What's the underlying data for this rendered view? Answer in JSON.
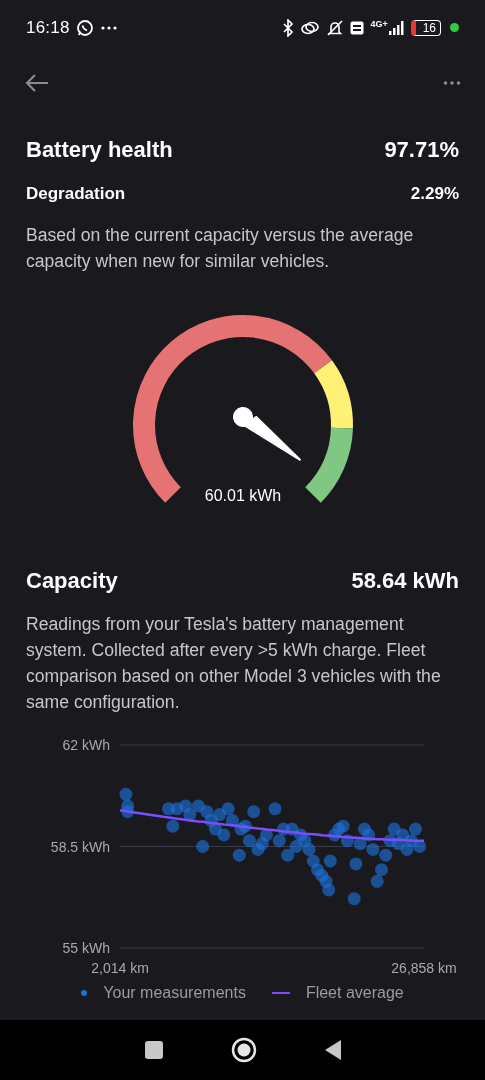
{
  "status_bar": {
    "time": "16:18",
    "network": "4G+",
    "battery": "16"
  },
  "health": {
    "title": "Battery health",
    "value": "97.71%",
    "degradation_label": "Degradation",
    "degradation_value": "2.29%",
    "description": "Based on the current capacity versus the average capacity when new for similar vehicles."
  },
  "gauge": {
    "reading": "60.01 kWh",
    "segments": [
      {
        "color": "#e57373"
      },
      {
        "color": "#fff176"
      },
      {
        "color": "#81c784"
      }
    ]
  },
  "capacity": {
    "title": "Capacity",
    "value": "58.64 kWh",
    "description": "Readings from your Tesla's battery management system. Collected after every >5 kWh charge. Fleet comparison based on other Model 3 vehicles with the same configuration.",
    "chart_data": {
      "type": "scatter",
      "xlim": [
        2014,
        26858
      ],
      "ylim": [
        55,
        62
      ],
      "xticks": [
        {
          "value": 2014,
          "label": "2,014 km"
        },
        {
          "value": 26858,
          "label": "26,858 km"
        }
      ],
      "yticks": [
        {
          "value": 62,
          "label": "62 kWh"
        },
        {
          "value": 58.5,
          "label": "58.5 kWh"
        },
        {
          "value": 55,
          "label": "55 kWh"
        }
      ],
      "x": [
        2014,
        2500,
        2640,
        2640,
        5980,
        6330,
        6680,
        7370,
        7720,
        8420,
        8770,
        9110,
        9460,
        9810,
        10160,
        10500,
        10850,
        11200,
        11760,
        11900,
        12250,
        12590,
        12940,
        13290,
        13640,
        13980,
        14680,
        15030,
        15380,
        15720,
        16070,
        16420,
        16770,
        17120,
        17460,
        17810,
        18160,
        18510,
        18860,
        19070,
        19200,
        19550,
        19900,
        20250,
        20600,
        21150,
        21290,
        21640,
        21990,
        22340,
        22680,
        23030,
        23380,
        23730,
        24080,
        24420,
        24770,
        25120,
        25470,
        25820,
        26160,
        26510,
        26858
      ],
      "series": [
        {
          "name": "Your measurements",
          "color": "#1e6fd6",
          "type": "scatter",
          "values": [
            null,
            60.3,
            59.9,
            59.7,
            59.8,
            59.2,
            59.8,
            59.9,
            59.6,
            59.9,
            58.5,
            59.7,
            59.4,
            59.1,
            59.6,
            58.9,
            59.8,
            59.4,
            58.2,
            59.1,
            59.2,
            58.7,
            59.7,
            58.4,
            58.6,
            58.9,
            59.8,
            58.7,
            59.1,
            58.2,
            59.1,
            58.5,
            58.9,
            58.7,
            58.4,
            58.0,
            57.7,
            57.5,
            57.3,
            57.0,
            58.0,
            58.9,
            59.1,
            59.2,
            58.7,
            56.7,
            57.9,
            58.6,
            59.1,
            58.9,
            58.4,
            57.3,
            57.7,
            58.2,
            58.7,
            59.1,
            58.6,
            58.9,
            58.4,
            58.7,
            59.1,
            58.5,
            null
          ]
        },
        {
          "name": "Fleet average",
          "color": "#7c4dff",
          "type": "line",
          "values": [
            59.75,
            59.72,
            59.71,
            59.71,
            59.5,
            59.48,
            59.46,
            59.42,
            59.4,
            59.36,
            59.35,
            59.33,
            59.31,
            59.3,
            59.28,
            59.26,
            59.25,
            59.23,
            59.2,
            59.19,
            59.18,
            59.16,
            59.14,
            59.12,
            59.11,
            59.09,
            59.06,
            59.04,
            59.02,
            59.01,
            58.99,
            58.98,
            58.96,
            58.94,
            58.93,
            58.92,
            58.91,
            58.89,
            58.88,
            58.87,
            58.87,
            58.85,
            58.84,
            58.83,
            58.82,
            58.8,
            58.8,
            58.79,
            58.78,
            58.77,
            58.76,
            58.75,
            58.75,
            58.74,
            58.73,
            58.73,
            58.72,
            58.72,
            58.71,
            58.71,
            58.7,
            58.7,
            58.7
          ]
        }
      ]
    }
  }
}
